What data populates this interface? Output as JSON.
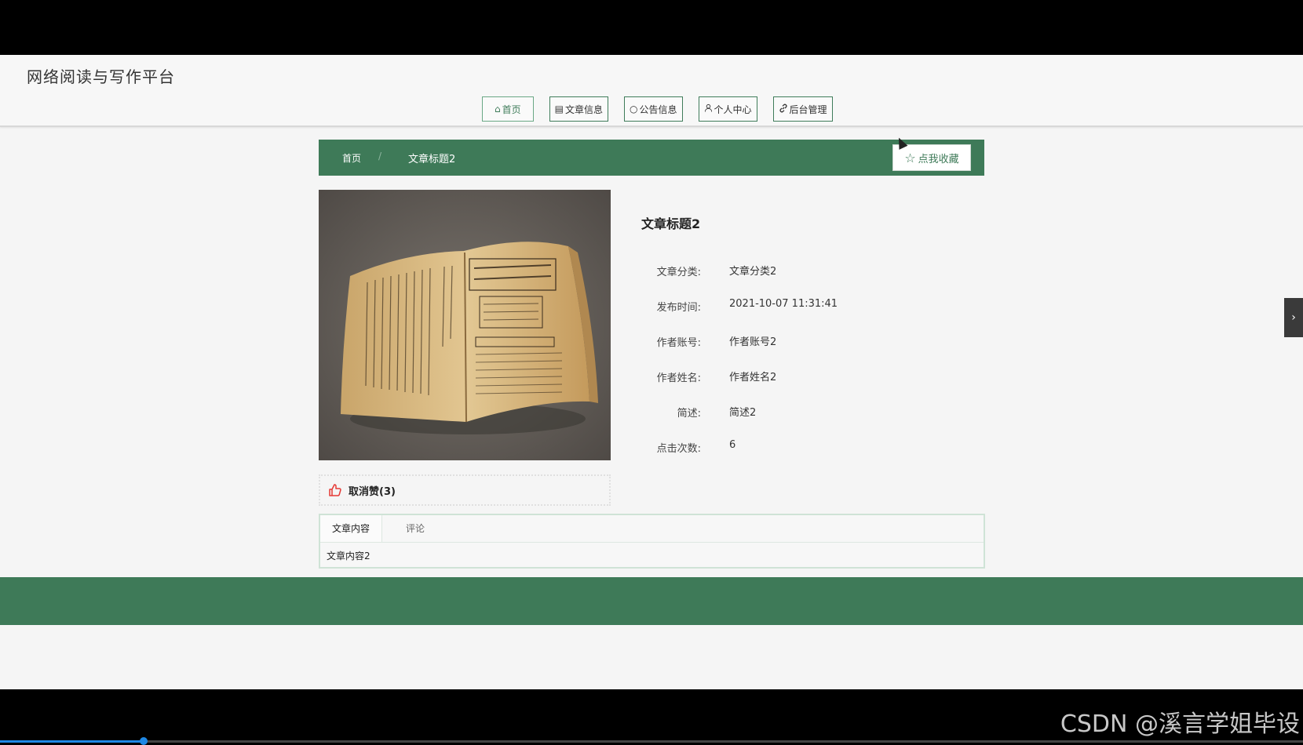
{
  "site": {
    "title": "网络阅读与写作平台"
  },
  "nav": {
    "items": [
      {
        "label": "首页",
        "icon": "home-icon"
      },
      {
        "label": "文章信息",
        "icon": "document-icon"
      },
      {
        "label": "公告信息",
        "icon": "chat-bubble-icon"
      },
      {
        "label": "个人中心",
        "icon": "user-icon"
      },
      {
        "label": "后台管理",
        "icon": "link-icon"
      }
    ]
  },
  "breadcrumb": {
    "home": "首页",
    "separator": "/",
    "current": "文章标题2"
  },
  "favorite": {
    "label": "点我收藏",
    "icon": "star-outline-icon"
  },
  "article": {
    "title": "文章标题2",
    "fields": [
      {
        "label": "文章分类:",
        "value": "文章分类2"
      },
      {
        "label": "发布时间:",
        "value": "2021-10-07 11:31:41"
      },
      {
        "label": "作者账号:",
        "value": "作者账号2"
      },
      {
        "label": "作者姓名:",
        "value": "作者姓名2"
      },
      {
        "label": "简述:",
        "value": "简述2"
      },
      {
        "label": "点击次数:",
        "value": "6"
      }
    ]
  },
  "like": {
    "label": "取消赞(3)",
    "icon": "thumbs-up-icon"
  },
  "tabs": {
    "items": [
      {
        "label": "文章内容"
      },
      {
        "label": "评论"
      }
    ],
    "content": "文章内容2"
  },
  "watermark": "CSDN @溪言学姐毕设",
  "video_progress": 0.11,
  "colors": {
    "primary": "#3e7a58",
    "background": "#f5f5f5",
    "like": "#e53935"
  }
}
